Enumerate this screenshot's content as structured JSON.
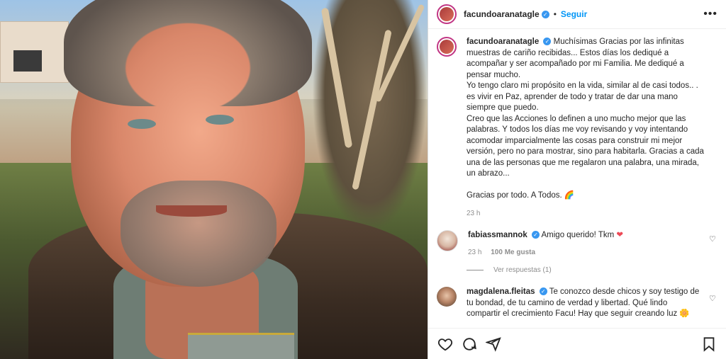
{
  "header": {
    "username": "facundoaranatagle",
    "follow_label": "Seguir",
    "separator": "•"
  },
  "caption": {
    "username": "facundoaranatagle",
    "paragraphs": [
      "Muchísimas Gracias por las infinitas muestras de cariño recibidas... Estos días los dediqué a acompañar y ser acompañado por mi Familia. Me dediqué a pensar mucho.",
      "Yo tengo claro mi propósito en la vida, similar al de casi todos.. . es vivir en Paz, aprender de todo y tratar de dar una mano siempre que puedo.",
      "Creo que las Acciones lo definen a uno mucho mejor que las palabras. Y todos los días me voy revisando y voy intentando acomodar imparcialmente las cosas para construir mi mejor versión, pero no para mostrar, sino para habitarla. Gracias a cada una de las personas que me regalaron una palabra, una mirada, un abrazo...",
      "Gracias por todo. A Todos. 🌈"
    ],
    "time": "23 h"
  },
  "comments": [
    {
      "username": "fabiassmannok",
      "text": "Amigo querido! Tkm",
      "time": "23 h",
      "likes": "100 Me gusta",
      "view_replies": "Ver respuestas (1)"
    },
    {
      "username": "magdalena.fleitas",
      "text": "Te conozco desde chicos y soy testigo de tu bondad, de tu camino de verdad y libertad. Qué lindo compartir el crecimiento Facu! Hay que seguir creando luz 🌼"
    }
  ],
  "icons": {
    "like": "heart-icon",
    "comment": "comment-icon",
    "share": "share-icon",
    "save": "bookmark-icon",
    "more": "more-options-icon",
    "verified": "verified-badge-icon"
  },
  "colors": {
    "accent": "#0095f6",
    "verified": "#3897f0",
    "heart": "#ed4956",
    "muted": "#8e8e8e"
  }
}
